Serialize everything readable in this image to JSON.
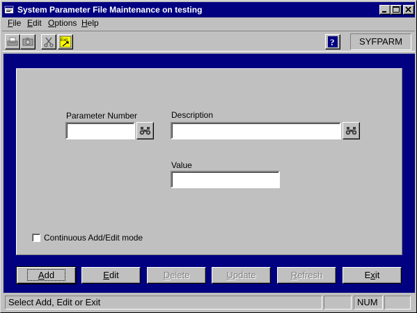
{
  "window": {
    "title": "System Parameter File Maintenance on testing",
    "controls": {
      "minimize": "minimize-icon",
      "maximize": "maximize-icon",
      "close": "close-icon"
    }
  },
  "menu": {
    "items": [
      {
        "label": "File",
        "accel": "F",
        "rest": "ile"
      },
      {
        "label": "Edit",
        "accel": "E",
        "rest": "dit"
      },
      {
        "label": "Options",
        "accel": "O",
        "rest": "ptions"
      },
      {
        "label": "Help",
        "accel": "H",
        "rest": "elp"
      }
    ]
  },
  "toolbar": {
    "tools": [
      "print-icon",
      "camera-icon",
      "scissors-icon",
      "exit-icon"
    ],
    "help_icon": "question-icon",
    "app_code": "SYFPARM"
  },
  "form": {
    "param_number_label": "Parameter Number",
    "param_number_value": "",
    "description_label": "Description",
    "description_value": "",
    "value_label": "Value",
    "value_value": "",
    "continuous_label": "Continuous Add/Edit mode",
    "continuous_checked": false
  },
  "buttons": {
    "add": {
      "accel": "A",
      "rest": "dd"
    },
    "edit": {
      "accel": "E",
      "rest": "dit"
    },
    "delete": {
      "accel": "D",
      "rest": "elete"
    },
    "update": {
      "accel": "U",
      "rest": "pdate"
    },
    "refresh": {
      "accel": "R",
      "rest": "efresh"
    },
    "exit": {
      "pre": "E",
      "accel": "x",
      "rest": "it"
    }
  },
  "status": {
    "message": "Select Add, Edit or Exit",
    "num": "NUM"
  },
  "colors": {
    "title_bar": "#000080",
    "panel": "#c0c0c0",
    "background": "#000080"
  }
}
